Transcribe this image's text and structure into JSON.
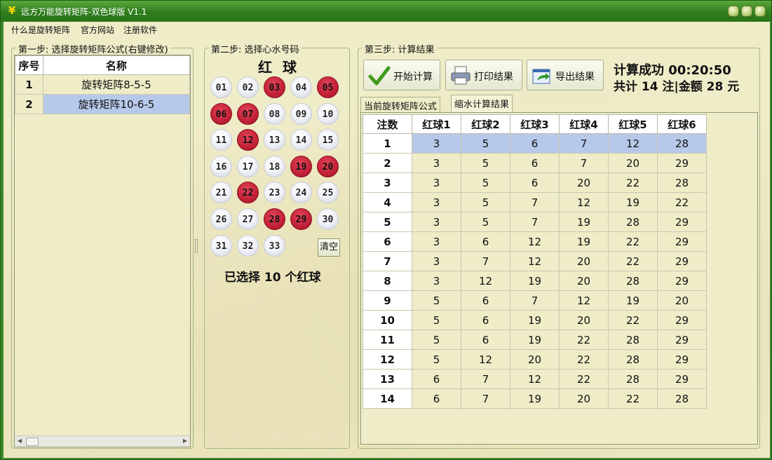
{
  "window": {
    "title": "远方万能旋转矩阵-双色球版 V1.1",
    "icon": "yen-icon"
  },
  "menu": [
    "什么是旋转矩阵",
    "官方网站",
    "注册软件"
  ],
  "step1": {
    "legend": "第一步: 选择旋转矩阵公式(右键修改)",
    "columns": [
      "序号",
      "名称"
    ],
    "rows": [
      {
        "idx": "1",
        "name": "旋转矩阵8-5-5"
      },
      {
        "idx": "2",
        "name": "旋转矩阵10-6-5"
      }
    ]
  },
  "step2": {
    "legend": "第二步: 选择心水号码",
    "title": "红 球",
    "balls": [
      {
        "n": "01",
        "on": false
      },
      {
        "n": "02",
        "on": false
      },
      {
        "n": "03",
        "on": true
      },
      {
        "n": "04",
        "on": false
      },
      {
        "n": "05",
        "on": true
      },
      {
        "n": "06",
        "on": true
      },
      {
        "n": "07",
        "on": true
      },
      {
        "n": "08",
        "on": false
      },
      {
        "n": "09",
        "on": false
      },
      {
        "n": "10",
        "on": false
      },
      {
        "n": "11",
        "on": false
      },
      {
        "n": "12",
        "on": true
      },
      {
        "n": "13",
        "on": false
      },
      {
        "n": "14",
        "on": false
      },
      {
        "n": "15",
        "on": false
      },
      {
        "n": "16",
        "on": false
      },
      {
        "n": "17",
        "on": false
      },
      {
        "n": "18",
        "on": false
      },
      {
        "n": "19",
        "on": true
      },
      {
        "n": "20",
        "on": true
      },
      {
        "n": "21",
        "on": false
      },
      {
        "n": "22",
        "on": true
      },
      {
        "n": "23",
        "on": false
      },
      {
        "n": "24",
        "on": false
      },
      {
        "n": "25",
        "on": false
      },
      {
        "n": "26",
        "on": false
      },
      {
        "n": "27",
        "on": false
      },
      {
        "n": "28",
        "on": true
      },
      {
        "n": "29",
        "on": true
      },
      {
        "n": "30",
        "on": false
      },
      {
        "n": "31",
        "on": false
      },
      {
        "n": "32",
        "on": false
      },
      {
        "n": "33",
        "on": false
      }
    ],
    "clear_label": "清空",
    "selected_text": "已选择 10 个红球"
  },
  "step3": {
    "legend": "第三步: 计算结果",
    "buttons": {
      "calc": "开始计算",
      "print": "打印结果",
      "export": "导出结果"
    },
    "status_line1": "计算成功 00:20:50",
    "status_line2": "共计 14 注|金额 28 元",
    "tabs": [
      "当前旋转矩阵公式",
      "缩水计算结果"
    ],
    "columns": [
      "注数",
      "红球1",
      "红球2",
      "红球3",
      "红球4",
      "红球5",
      "红球6"
    ],
    "rows": [
      [
        "1",
        "3",
        "5",
        "6",
        "7",
        "12",
        "28"
      ],
      [
        "2",
        "3",
        "5",
        "6",
        "7",
        "20",
        "29"
      ],
      [
        "3",
        "3",
        "5",
        "6",
        "20",
        "22",
        "28"
      ],
      [
        "4",
        "3",
        "5",
        "7",
        "12",
        "19",
        "22"
      ],
      [
        "5",
        "3",
        "5",
        "7",
        "19",
        "28",
        "29"
      ],
      [
        "6",
        "3",
        "6",
        "12",
        "19",
        "22",
        "29"
      ],
      [
        "7",
        "3",
        "7",
        "12",
        "20",
        "22",
        "29"
      ],
      [
        "8",
        "3",
        "12",
        "19",
        "20",
        "28",
        "29"
      ],
      [
        "9",
        "5",
        "6",
        "7",
        "12",
        "19",
        "20"
      ],
      [
        "10",
        "5",
        "6",
        "19",
        "20",
        "22",
        "29"
      ],
      [
        "11",
        "5",
        "6",
        "19",
        "22",
        "28",
        "29"
      ],
      [
        "12",
        "5",
        "12",
        "20",
        "22",
        "28",
        "29"
      ],
      [
        "13",
        "6",
        "7",
        "12",
        "22",
        "28",
        "29"
      ],
      [
        "14",
        "6",
        "7",
        "19",
        "20",
        "22",
        "28"
      ]
    ]
  }
}
